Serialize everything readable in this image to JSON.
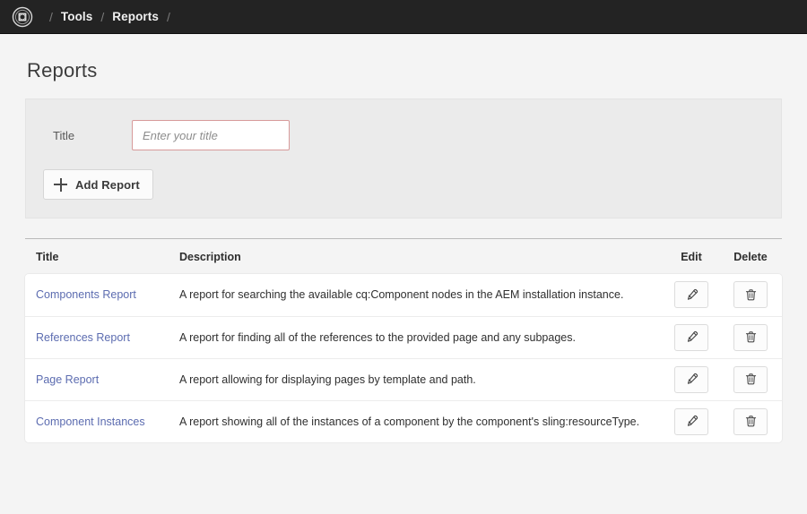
{
  "header": {
    "logo_icon": "aem-logo-icon",
    "breadcrumb": {
      "lead_separator": "/",
      "items": [
        {
          "label": "Tools"
        },
        {
          "label": "Reports"
        }
      ],
      "separator": "/",
      "trail_separator": "/"
    }
  },
  "page": {
    "title": "Reports"
  },
  "form": {
    "title_label": "Title",
    "title_value": "",
    "title_placeholder": "Enter your title",
    "add_button_label": "Add Report",
    "add_button_icon": "plus-icon"
  },
  "table": {
    "columns": {
      "title": "Title",
      "description": "Description",
      "edit": "Edit",
      "delete": "Delete"
    },
    "edit_icon": "pencil-icon",
    "delete_icon": "trash-icon",
    "rows": [
      {
        "title": "Components Report",
        "description": "A report for searching the available cq:Component nodes in the AEM installation instance."
      },
      {
        "title": "References Report",
        "description": "A report for finding all of the references to the provided page and any subpages."
      },
      {
        "title": "Page Report",
        "description": "A report allowing for displaying pages by template and path."
      },
      {
        "title": "Component Instances",
        "description": "A report showing all of the instances of a component by the component's sling:resourceType."
      }
    ]
  },
  "colors": {
    "header_bg": "#232323",
    "page_bg": "#f4f4f4",
    "panel_bg": "#ebebeb",
    "link": "#5c6cb0",
    "input_border": "#d79a9a"
  }
}
